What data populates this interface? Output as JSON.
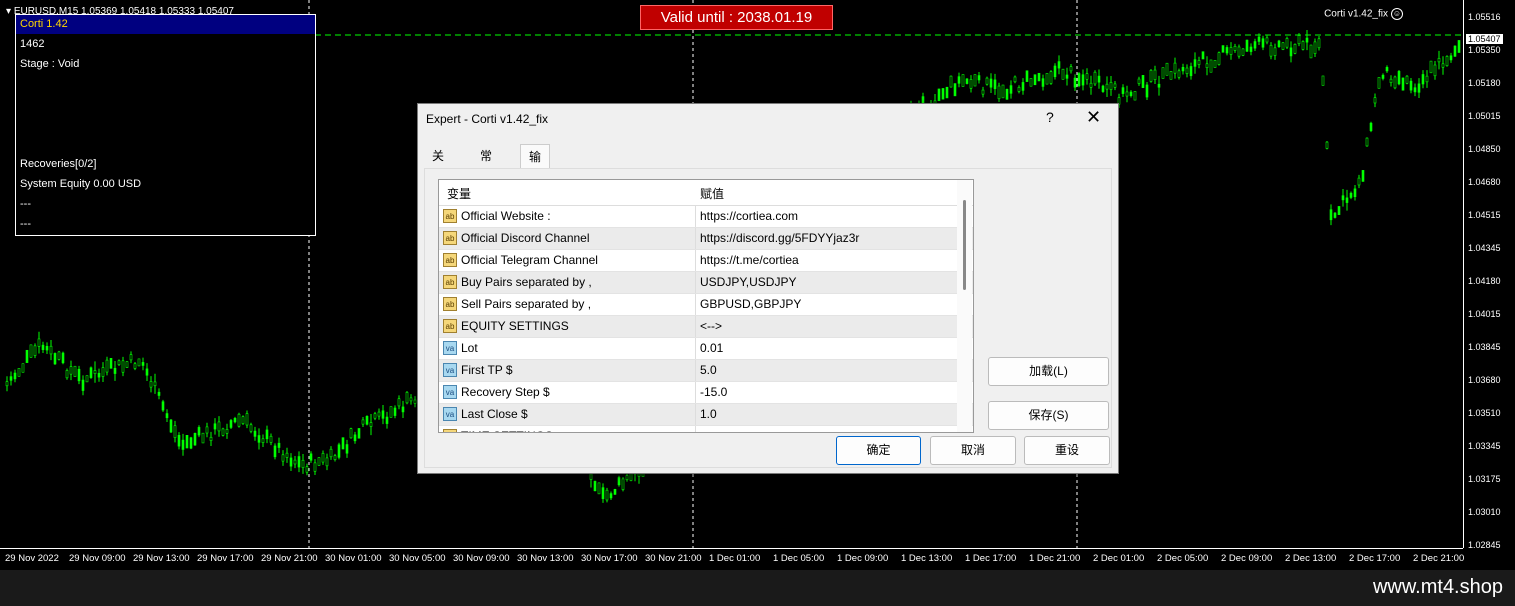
{
  "chart": {
    "symbol_line": "EURUSD,M15  1.05369 1.05418 1.05333 1.05407",
    "ea_label": "Corti v1.42_fix",
    "valid_banner": "Valid until : 2038.01.19",
    "current_price": "1.05407",
    "price_ticks": [
      "1.05516",
      "1.05350",
      "1.05180",
      "1.05015",
      "1.04850",
      "1.04680",
      "1.04515",
      "1.04345",
      "1.04180",
      "1.04015",
      "1.03845",
      "1.03680",
      "1.03510",
      "1.03345",
      "1.03175",
      "1.03010",
      "1.02845"
    ],
    "time_ticks": [
      "29 Nov 2022",
      "29 Nov 09:00",
      "29 Nov 13:00",
      "29 Nov 17:00",
      "29 Nov 21:00",
      "30 Nov 01:00",
      "30 Nov 05:00",
      "30 Nov 09:00",
      "30 Nov 13:00",
      "30 Nov 17:00",
      "30 Nov 21:00",
      "1 Dec 01:00",
      "1 Dec 05:00",
      "1 Dec 09:00",
      "1 Dec 13:00",
      "1 Dec 17:00",
      "1 Dec 21:00",
      "2 Dec 01:00",
      "2 Dec 05:00",
      "2 Dec 09:00",
      "2 Dec 13:00",
      "2 Dec 17:00",
      "2 Dec 21:00"
    ],
    "candle_color": "#00ff00",
    "watermark": "www.mt4.shop"
  },
  "info_panel": {
    "title": "Corti 1.42",
    "magic": "1462",
    "stage": "Stage : Void",
    "recoveries": "Recoveries[0/2]",
    "equity": "System Equity 0.00 USD",
    "line_a": "---",
    "line_b": "---"
  },
  "dialog": {
    "title": "Expert - Corti v1.42_fix",
    "help": "?",
    "close": "✕",
    "tabs": [
      "关于",
      "常用",
      "输入参数"
    ],
    "col_variable": "变量",
    "col_value": "赋值",
    "rows": [
      {
        "type": "ab",
        "name": "Official Website :",
        "value": "https://cortiea.com"
      },
      {
        "type": "ab",
        "name": "Official Discord Channel",
        "value": "https://discord.gg/5FDYYjaz3r"
      },
      {
        "type": "ab",
        "name": "Official Telegram Channel",
        "value": "https://t.me/cortiea"
      },
      {
        "type": "ab",
        "name": "Buy Pairs separated by ,",
        "value": "USDJPY,USDJPY"
      },
      {
        "type": "ab",
        "name": "Sell Pairs separated by ,",
        "value": "GBPUSD,GBPJPY"
      },
      {
        "type": "ab",
        "name": "EQUITY SETTINGS",
        "value": "<-->"
      },
      {
        "type": "va",
        "name": "Lot",
        "value": "0.01"
      },
      {
        "type": "va",
        "name": "First TP $",
        "value": "5.0"
      },
      {
        "type": "va",
        "name": "Recovery Step $",
        "value": "-15.0"
      },
      {
        "type": "va",
        "name": "Last Close $",
        "value": "1.0"
      },
      {
        "type": "ab",
        "name": "TIME SETTINGS",
        "value": "<-->"
      }
    ],
    "load_button": "加载(L)",
    "save_button": "保存(S)",
    "ok_button": "确定",
    "cancel_button": "取消",
    "reset_button": "重设"
  }
}
